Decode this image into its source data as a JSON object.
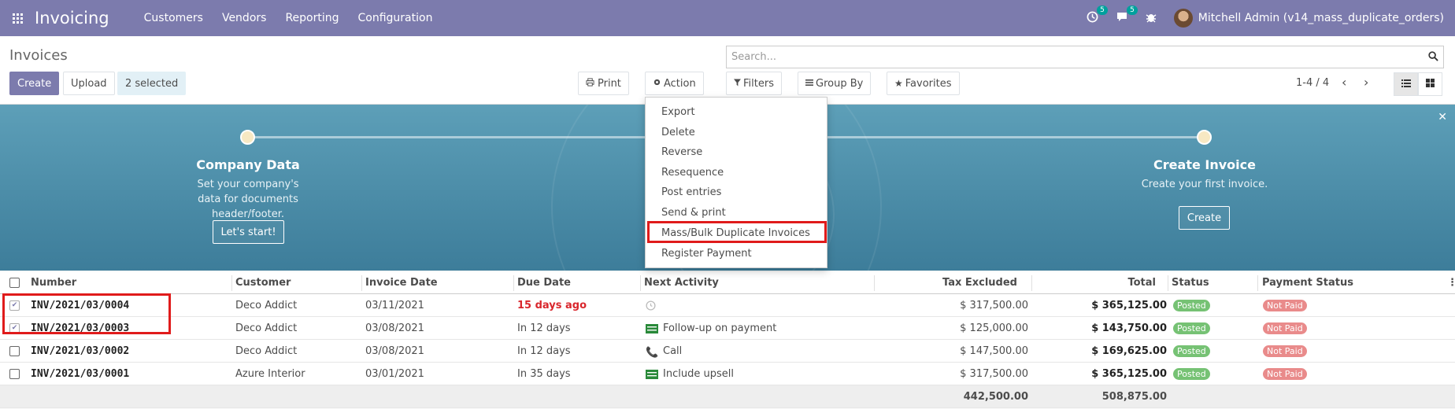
{
  "navbar": {
    "app_name": "Invoicing",
    "menu": [
      "Customers",
      "Vendors",
      "Reporting",
      "Configuration"
    ],
    "activity_count": "5",
    "message_count": "5",
    "user_name": "Mitchell Admin (v14_mass_duplicate_orders)"
  },
  "control_panel": {
    "title": "Invoices",
    "create_label": "Create",
    "upload_label": "Upload",
    "selected_label": "2 selected",
    "print_label": "Print",
    "action_label": "Action",
    "filters_label": "Filters",
    "group_by_label": "Group By",
    "favorites_label": "Favorites",
    "search_placeholder": "Search...",
    "pager": "1-4 / 4"
  },
  "action_menu": {
    "items": [
      "Export",
      "Delete",
      "Reverse",
      "Resequence",
      "Post entries",
      "Send & print",
      "Mass/Bulk Duplicate Invoices",
      "Register Payment"
    ]
  },
  "banner": {
    "step1_title": "Company Data",
    "step1_desc": "Set your company's data for documents header/footer.",
    "step1_button": "Let's start!",
    "step3_title": "Create Invoice",
    "step3_desc": "Create your first invoice.",
    "step3_button": "Create"
  },
  "table": {
    "headers": {
      "number": "Number",
      "customer": "Customer",
      "invoice_date": "Invoice Date",
      "due_date": "Due Date",
      "next_activity": "Next Activity",
      "tax_excluded": "Tax Excluded",
      "total": "Total",
      "status": "Status",
      "payment_status": "Payment Status"
    },
    "rows": [
      {
        "number": "INV/2021/03/0004",
        "customer": "Deco Addict",
        "invoice_date": "03/11/2021",
        "due_date": "15 days ago",
        "activity": "",
        "tax_excluded": "$ 317,500.00",
        "total": "$ 365,125.00",
        "status": "Posted",
        "payment_status": "Not Paid"
      },
      {
        "number": "INV/2021/03/0003",
        "customer": "Deco Addict",
        "invoice_date": "03/08/2021",
        "due_date": "In 12 days",
        "activity": "Follow-up on payment",
        "tax_excluded": "$ 125,000.00",
        "total": "$ 143,750.00",
        "status": "Posted",
        "payment_status": "Not Paid"
      },
      {
        "number": "INV/2021/03/0002",
        "customer": "Deco Addict",
        "invoice_date": "03/08/2021",
        "due_date": "In 12 days",
        "activity": "Call",
        "tax_excluded": "$ 147,500.00",
        "total": "$ 169,625.00",
        "status": "Posted",
        "payment_status": "Not Paid"
      },
      {
        "number": "INV/2021/03/0001",
        "customer": "Azure Interior",
        "invoice_date": "03/01/2021",
        "due_date": "In 35 days",
        "activity": "Include upsell",
        "tax_excluded": "$ 317,500.00",
        "total": "$ 365,125.00",
        "status": "Posted",
        "payment_status": "Not Paid"
      }
    ],
    "footer": {
      "tax_excluded": "442,500.00",
      "total": "508,875.00"
    }
  },
  "colors": {
    "brand": "#7c7bad",
    "highlight": "#e01b1b",
    "posted": "#76c274",
    "not_paid": "#e98b8b"
  }
}
